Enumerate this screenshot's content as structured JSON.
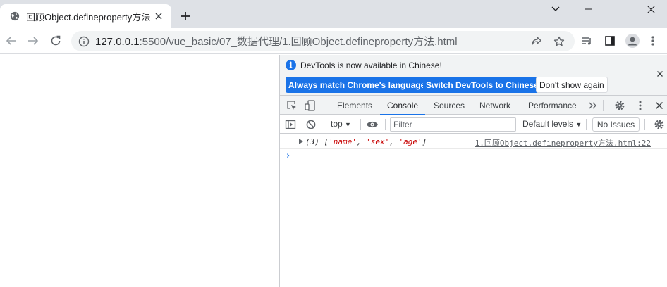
{
  "tab": {
    "title": "回顾Object.defineproperty方法"
  },
  "omnibox": {
    "url_host": "127.0.0.1",
    "url_rest": ":5500/vue_basic/07_数据代理/1.回顾Object.defineproperty方法.html"
  },
  "devtools": {
    "infobar": {
      "message": "DevTools is now available in Chinese!",
      "btn_match": "Always match Chrome's language",
      "btn_switch": "Switch DevTools to Chinese",
      "btn_dont_show": "Don't show again"
    },
    "tabs": [
      "Elements",
      "Console",
      "Sources",
      "Network",
      "Performance"
    ],
    "active_tab": "Console",
    "console_toolbar": {
      "context": "top",
      "filter_placeholder": "Filter",
      "levels": "Default levels",
      "issues": "No Issues"
    },
    "log": {
      "prefix": "(3) [",
      "items": [
        "'name'",
        "'sex'",
        "'age'"
      ],
      "sep": ", ",
      "suffix": "]",
      "source": "1.回顾Object.defineproperty方法.html:22"
    },
    "prompt_symbol": "›"
  },
  "colors": {
    "accent": "#1a73e8",
    "string": "#c80000",
    "tabstrip": "#dee1e6"
  }
}
